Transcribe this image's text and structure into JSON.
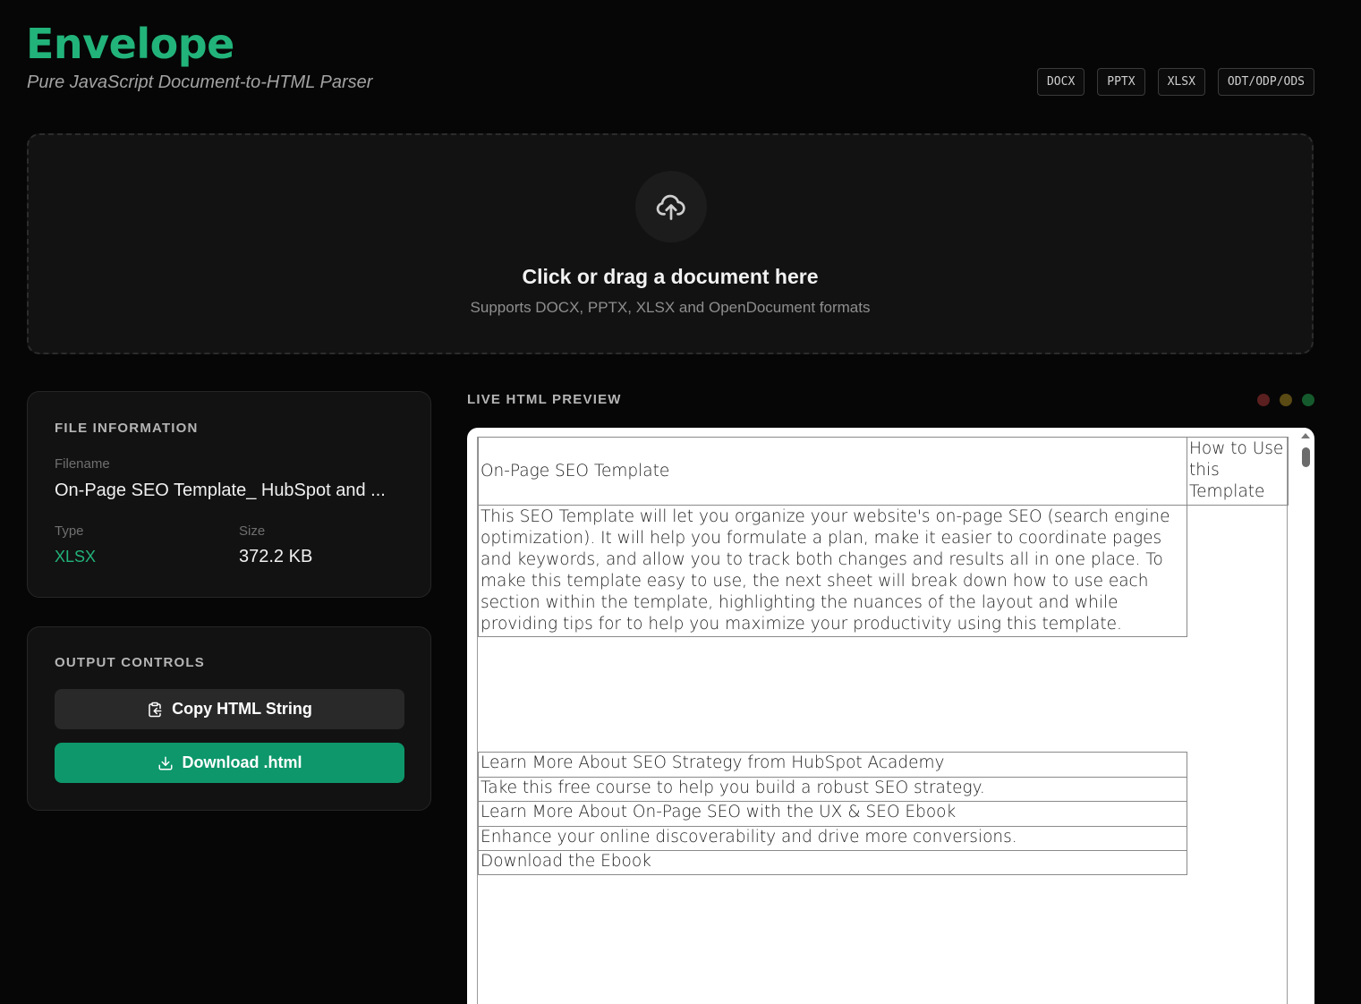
{
  "header": {
    "title": "Envelope",
    "subtitle": "Pure JavaScript Document-to-HTML Parser",
    "formats": [
      "DOCX",
      "PPTX",
      "XLSX",
      "ODT/ODP/ODS"
    ]
  },
  "dropzone": {
    "icon": "cloud-upload-icon",
    "title": "Click or drag a document here",
    "subtitle": "Supports DOCX, PPTX, XLSX and OpenDocument formats"
  },
  "file_info": {
    "heading": "FILE INFORMATION",
    "filename_label": "Filename",
    "filename": "On-Page SEO Template_ HubSpot and ...",
    "type_label": "Type",
    "type": "XLSX",
    "size_label": "Size",
    "size": "372.2 KB"
  },
  "output_controls": {
    "heading": "OUTPUT CONTROLS",
    "copy_label": "Copy HTML String",
    "download_label": "Download .html"
  },
  "preview": {
    "heading": "LIVE HTML PREVIEW",
    "window_dots": [
      "#5a1f1f",
      "#5a4a14",
      "#155a2c"
    ],
    "cells": {
      "title": "On-Page SEO Template",
      "how_to_use": "How to Use this Template",
      "description": "This SEO Template will let you organize your website's on-page SEO (search engine optimization). It will help you formulate a plan, make it easier to coordinate pages and keywords, and allow you to track both changes and results all in one place. To make this template easy to use, the next sheet will break down how to use each section within the template, highlighting the nuances of the layout and while providing tips for to help you maximize your productivity using this template.",
      "links": [
        "Learn More About SEO Strategy from HubSpot Academy",
        "Take this free course to help you build a robust SEO strategy.",
        "Learn More About On-Page SEO with the UX & SEO Ebook",
        "Enhance your online discoverability and drive more conversions.",
        "Download the Ebook"
      ]
    }
  },
  "colors": {
    "accent": "#22b37a",
    "download_button": "#0d976a",
    "background": "#060606",
    "card": "#121212"
  }
}
